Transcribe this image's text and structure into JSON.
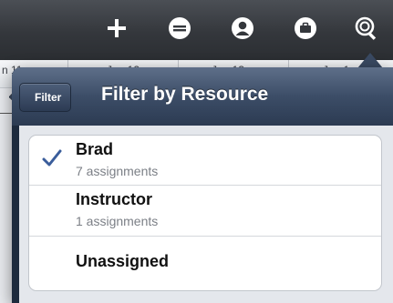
{
  "toolbar": {
    "icons": [
      "plus-icon",
      "minus-icon",
      "person-icon",
      "briefcase-icon",
      "magnifier-icon"
    ]
  },
  "timeline": {
    "labels": [
      "n 11",
      "Jun 12",
      "Jun 13",
      "Jun 1"
    ]
  },
  "popover": {
    "back_label": "Filter",
    "title": "Filter by Resource",
    "items": [
      {
        "name": "Brad",
        "subtitle": "7 assignments",
        "checked": true
      },
      {
        "name": "Instructor",
        "subtitle": "1 assignments",
        "checked": false
      },
      {
        "name": "Unassigned",
        "subtitle": "",
        "checked": false
      }
    ]
  },
  "colors": {
    "nav_bar": "#3c4d67",
    "check": "#3a5d9b",
    "toolbar": "#34373c"
  }
}
